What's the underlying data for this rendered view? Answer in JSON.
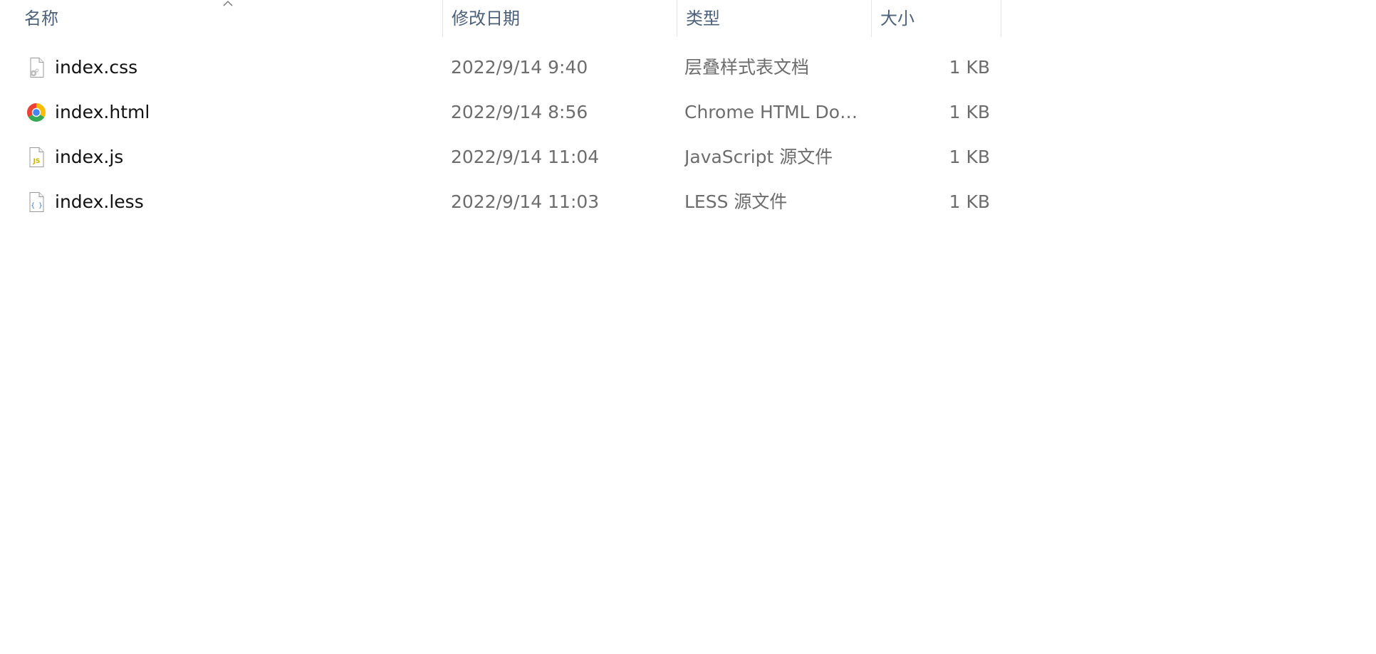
{
  "columns": {
    "name": "名称",
    "date": "修改日期",
    "type": "类型",
    "size": "大小"
  },
  "sort": {
    "column": "name",
    "direction": "ascending",
    "icon": "chevron-up-icon"
  },
  "files": [
    {
      "name": "index.css",
      "date": "2022/9/14 9:40",
      "type": "层叠样式表文档",
      "size": "1 KB",
      "icon": "css-file-icon"
    },
    {
      "name": "index.html",
      "date": "2022/9/14 8:56",
      "type": "Chrome HTML Doc...",
      "size": "1 KB",
      "icon": "chrome-icon"
    },
    {
      "name": "index.js",
      "date": "2022/9/14 11:04",
      "type": "JavaScript 源文件",
      "size": "1 KB",
      "icon": "js-file-icon"
    },
    {
      "name": "index.less",
      "date": "2022/9/14 11:03",
      "type": "LESS 源文件",
      "size": "1 KB",
      "icon": "less-file-icon"
    }
  ],
  "colors": {
    "header_text": "#4c607a",
    "name_text": "#111111",
    "detail_text": "#6d6d6d",
    "divider": "#e5e5e5"
  }
}
